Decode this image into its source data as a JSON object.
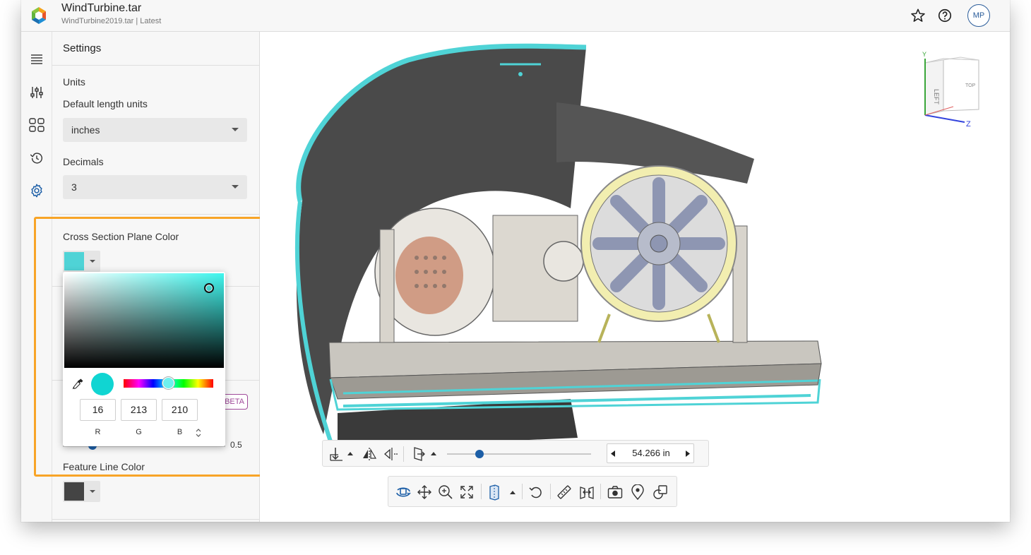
{
  "header": {
    "title": "WindTurbine.tar",
    "subtitle": "WindTurbine2019.tar | Latest",
    "avatar_initials": "MP",
    "icons": [
      "app-logo-icon",
      "star-icon",
      "help-icon"
    ]
  },
  "rail": {
    "items": [
      "menu-icon",
      "filters-icon",
      "apps-grid-icon",
      "history-icon",
      "settings-icon"
    ],
    "active": "settings-icon"
  },
  "settings": {
    "title": "Settings",
    "units_heading": "Units",
    "length_units_label": "Default length units",
    "length_units_value": "inches",
    "decimals_label": "Decimals",
    "decimals_value": "3",
    "cross_section_label": "Cross Section Plane Color",
    "cross_section_color": "#10d5d2",
    "beta_badge": "BETA",
    "slider_value": "0.5",
    "feature_line_label": "Feature Line Color",
    "feature_line_color": "#444444"
  },
  "color_picker": {
    "r": "16",
    "g": "213",
    "b": "210",
    "r_label": "R",
    "g_label": "G",
    "b_label": "B",
    "mode_toggle": "⌃⌄"
  },
  "viewport": {
    "navcube": {
      "faces": [
        "LEFT",
        "TOP"
      ],
      "axes": [
        "Y",
        "Z"
      ]
    },
    "section_distance": "54.266 in",
    "section_slider_fraction": 0.22
  },
  "colors": {
    "accent_blue": "#1d5fa7",
    "highlight_orange": "#f8a427",
    "section_cyan": "#4fd3d6"
  }
}
